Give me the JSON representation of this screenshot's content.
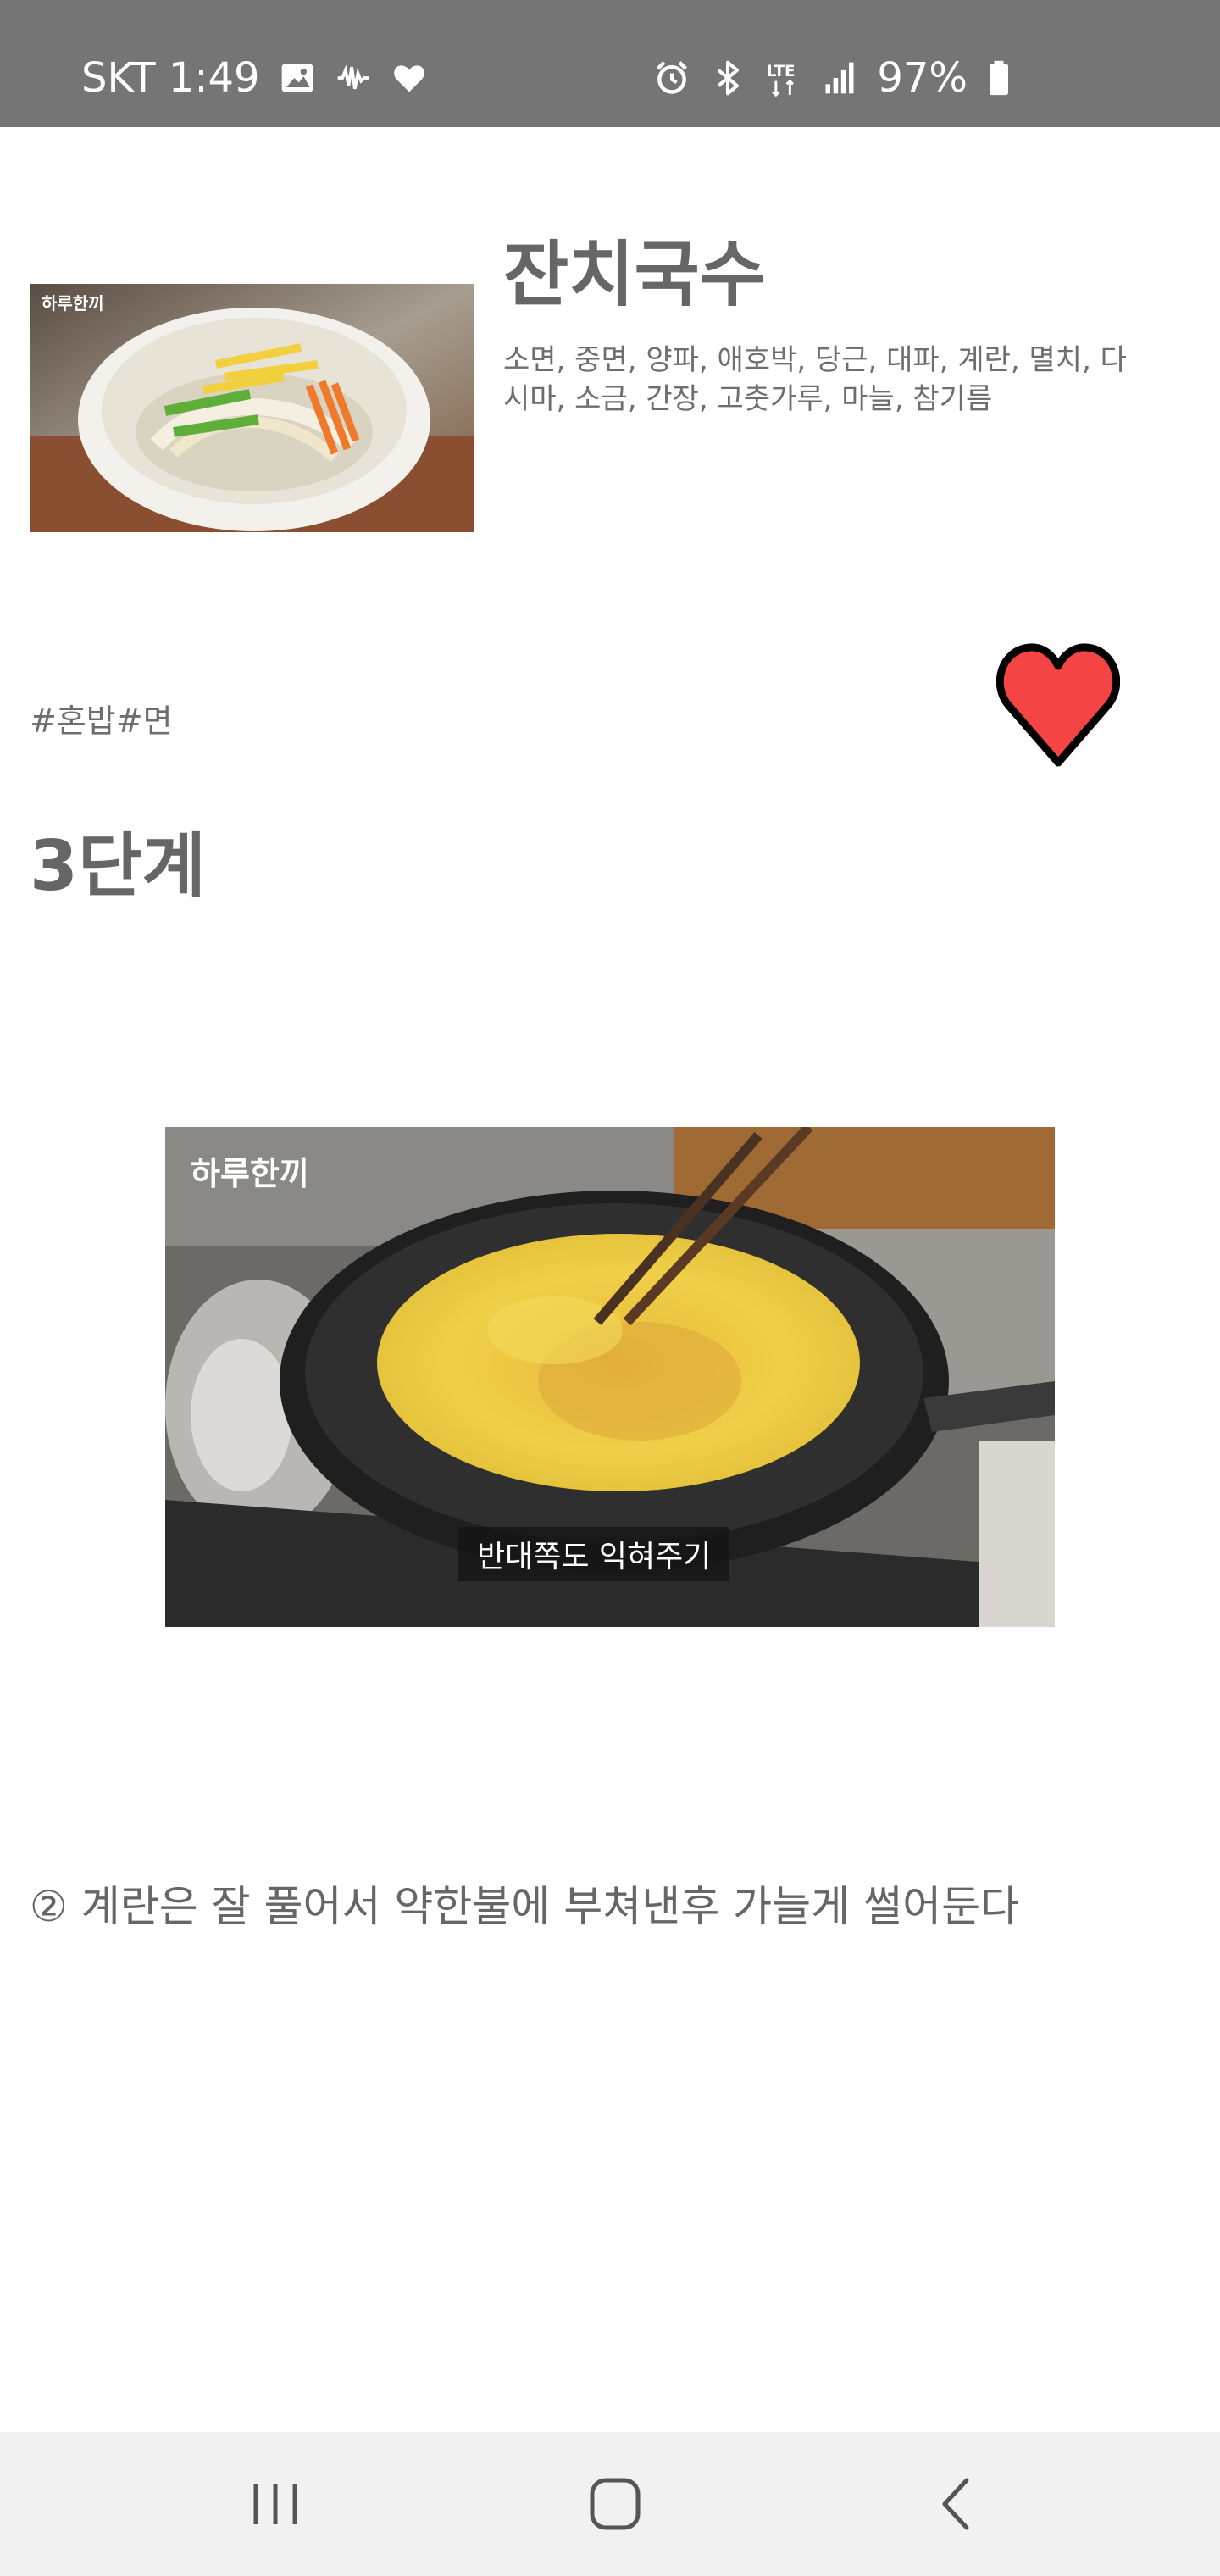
{
  "status_bar": {
    "carrier_time": "SKT 1:49",
    "network": "LTE",
    "battery": "97%",
    "left_icons": [
      "image-icon",
      "voicemail-icon",
      "heart-icon"
    ],
    "right_icons": [
      "alarm-icon",
      "bluetooth-icon",
      "lte-icon",
      "signal-icon",
      "battery-icon"
    ]
  },
  "recipe": {
    "title": "잔치국수",
    "ingredients": "소면, 중면, 양파, 애호박, 당근, 대파, 계란, 멸치, 다시마, 소금, 간장, 고춧가루, 마늘, 참기름",
    "tags": "#혼밥#면",
    "favorite": true,
    "favorite_color": "#f44444",
    "thumbnail_logo": "하루한끼"
  },
  "step": {
    "title": "3단계",
    "photo_logo": "하루한끼",
    "photo_caption": "반대쪽도 익혀주기",
    "description": "② 계란은 잘 풀어서 약한불에 부쳐낸후 가늘게 썰어둔다"
  },
  "nav_bar": {
    "buttons": [
      "recent-apps",
      "home",
      "back"
    ]
  },
  "colors": {
    "status_bar_bg": "#757575",
    "nav_bar_bg": "#f1f1f1",
    "text": "#666666"
  }
}
